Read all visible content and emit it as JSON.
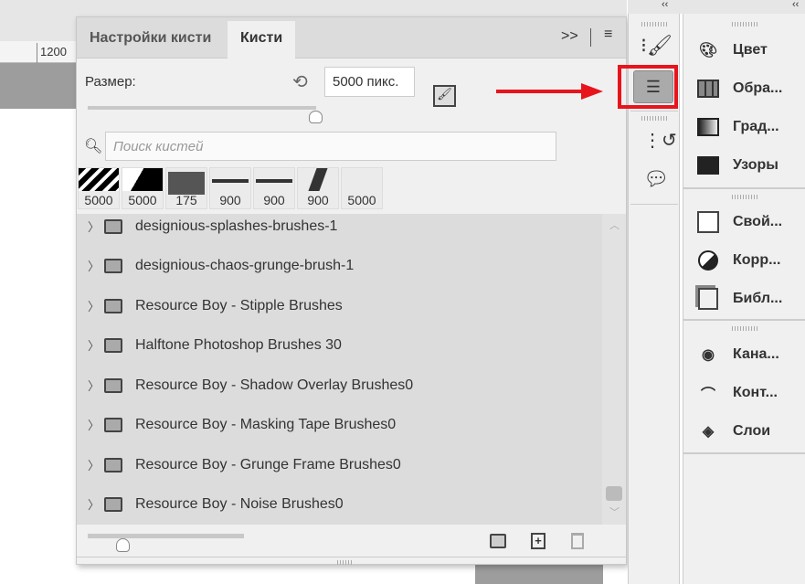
{
  "ruler": {
    "label": "1200"
  },
  "panel": {
    "tabs": [
      {
        "label": "Настройки кисти"
      },
      {
        "label": "Кисти"
      }
    ],
    "size_label": "Размер:",
    "size_value": "5000 пикс.",
    "size_slider_fraction": 0.83,
    "search_placeholder": "Поиск кистей",
    "thumbnails": [
      "5000",
      "5000",
      "175",
      "900",
      "900",
      "900",
      "5000"
    ],
    "folders": [
      "designious-splashes-brushes-1",
      "designious-chaos-grunge-brush-1",
      "Resource Boy - Stipple Brushes",
      "Halftone Photoshop Brushes 30",
      "Resource Boy - Shadow Overlay Brushes0",
      "Resource Boy - Masking Tape Brushes0",
      "Resource Boy - Grunge Frame Brushes0",
      "Resource Boy - Noise Brushes0"
    ]
  },
  "right_panels": [
    {
      "group": 1,
      "items": [
        {
          "label": "Цвет"
        },
        {
          "label": "Обра..."
        },
        {
          "label": "Град..."
        },
        {
          "label": "Узоры"
        }
      ]
    },
    {
      "group": 2,
      "items": [
        {
          "label": "Свой..."
        },
        {
          "label": "Корр..."
        },
        {
          "label": "Библ..."
        }
      ]
    },
    {
      "group": 3,
      "items": [
        {
          "label": "Кана..."
        },
        {
          "label": "Конт..."
        },
        {
          "label": "Слои"
        }
      ]
    }
  ],
  "colors": {
    "highlight": "#e8141c",
    "arrow": "#e8141c"
  }
}
